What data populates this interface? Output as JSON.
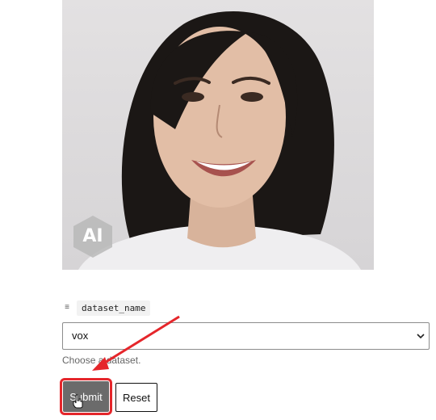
{
  "image": {
    "description_icon": "portrait-photo",
    "badge_text": "AI"
  },
  "form": {
    "param_icon": "list-icon",
    "param_name": "dataset_name",
    "select_value": "vox",
    "helper_text": "Choose a dataset.",
    "submit_label": "Submit",
    "reset_label": "Reset"
  },
  "colors": {
    "highlight": "#e5262b",
    "submit_bg": "#6b6b6b"
  }
}
